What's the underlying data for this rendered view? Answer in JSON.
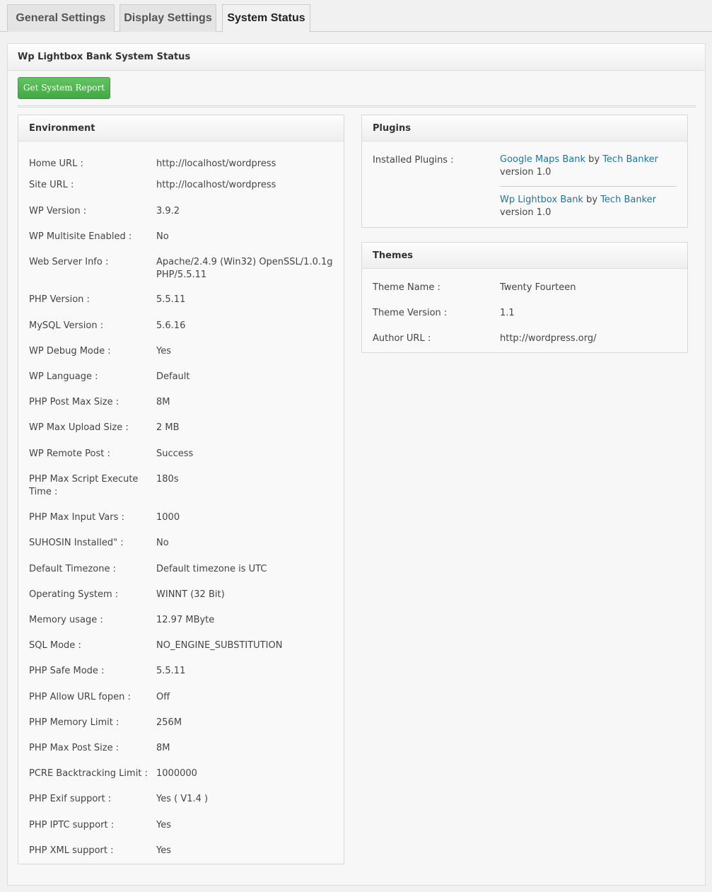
{
  "tabs": [
    {
      "label": "General Settings",
      "active": false
    },
    {
      "label": "Display Settings",
      "active": false
    },
    {
      "label": "System Status",
      "active": true
    }
  ],
  "page_title": "Wp Lightbox Bank System Status",
  "report_button": "Get System Report",
  "environment": {
    "title": "Environment",
    "rows": [
      {
        "label": "Home URL :",
        "value": "http://localhost/wordpress"
      },
      {
        "label": "Site URL :",
        "value": "http://localhost/wordpress"
      },
      {
        "label": "WP Version :",
        "value": "3.9.2"
      },
      {
        "label": "WP Multisite Enabled :",
        "value": "No"
      },
      {
        "label": "Web Server Info :",
        "value": "Apache/2.4.9 (Win32) OpenSSL/1.0.1g PHP/5.5.11"
      },
      {
        "label": "PHP Version :",
        "value": "5.5.11"
      },
      {
        "label": "MySQL Version :",
        "value": "5.6.16"
      },
      {
        "label": "WP Debug Mode :",
        "value": "Yes"
      },
      {
        "label": "WP Language :",
        "value": "Default"
      },
      {
        "label": "PHP Post Max Size :",
        "value": "8M"
      },
      {
        "label": "WP Max Upload Size :",
        "value": "2 MB"
      },
      {
        "label": "WP Remote Post :",
        "value": "Success"
      },
      {
        "label": "PHP Max Script Execute Time :",
        "value": "180s"
      },
      {
        "label": "PHP Max Input Vars :",
        "value": "1000"
      },
      {
        "label": "SUHOSIN Installed\" :",
        "value": "No"
      },
      {
        "label": "Default Timezone :",
        "value": "Default timezone is UTC"
      },
      {
        "label": "Operating System :",
        "value": "WINNT (32 Bit)"
      },
      {
        "label": "Memory usage :",
        "value": "12.97 MByte"
      },
      {
        "label": "SQL Mode :",
        "value": "NO_ENGINE_SUBSTITUTION"
      },
      {
        "label": "PHP Safe Mode :",
        "value": "5.5.11"
      },
      {
        "label": "PHP Allow URL fopen :",
        "value": "Off"
      },
      {
        "label": "PHP Memory Limit :",
        "value": "256M"
      },
      {
        "label": "PHP Max Post Size :",
        "value": "8M"
      },
      {
        "label": "PCRE Backtracking Limit :",
        "value": "1000000"
      },
      {
        "label": "PHP Exif support :",
        "value": "Yes ( V1.4 )"
      },
      {
        "label": "PHP IPTC support :",
        "value": "Yes"
      },
      {
        "label": "PHP XML support :",
        "value": "Yes"
      }
    ]
  },
  "plugins": {
    "title": "Plugins",
    "label": "Installed Plugins :",
    "by": "by",
    "items": [
      {
        "name": "Google Maps Bank",
        "author": "Tech Banker",
        "version": "version 1.0"
      },
      {
        "name": "Wp Lightbox Bank",
        "author": "Tech Banker",
        "version": "version 1.0"
      }
    ]
  },
  "themes": {
    "title": "Themes",
    "rows": [
      {
        "label": "Theme Name :",
        "value": "Twenty Fourteen"
      },
      {
        "label": "Theme Version :",
        "value": "1.1"
      },
      {
        "label": "Author URL :",
        "value": "http://wordpress.org/"
      }
    ]
  }
}
